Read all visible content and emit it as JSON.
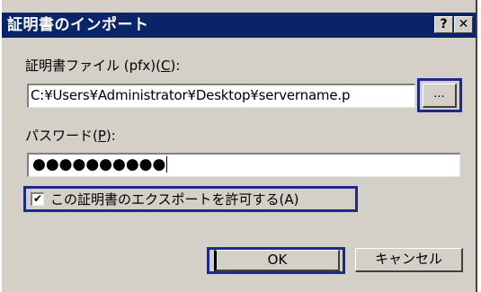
{
  "dialog": {
    "title": "証明書のインポート",
    "help_button": "?",
    "close_button": "✕"
  },
  "file_section": {
    "label_prefix": "証明書ファイル (pfx)(",
    "label_accel": "C",
    "label_suffix": "):",
    "path_value": "C:¥Users¥Administrator¥Desktop¥servername.p",
    "browse_label": "..."
  },
  "password_section": {
    "label_prefix": "パスワード(",
    "label_accel": "P",
    "label_suffix": "):",
    "masked_value": "●●●●●●●●●●"
  },
  "export_option": {
    "checked_mark": "✔",
    "label": "この証明書のエクスポートを許可する(A)"
  },
  "buttons": {
    "ok_label": "OK",
    "cancel_label": "キャンセル"
  },
  "colors": {
    "titlebar": "#0a246a",
    "dialog_face": "#d4d0c8",
    "highlight_outline": "#1c2a8c"
  }
}
